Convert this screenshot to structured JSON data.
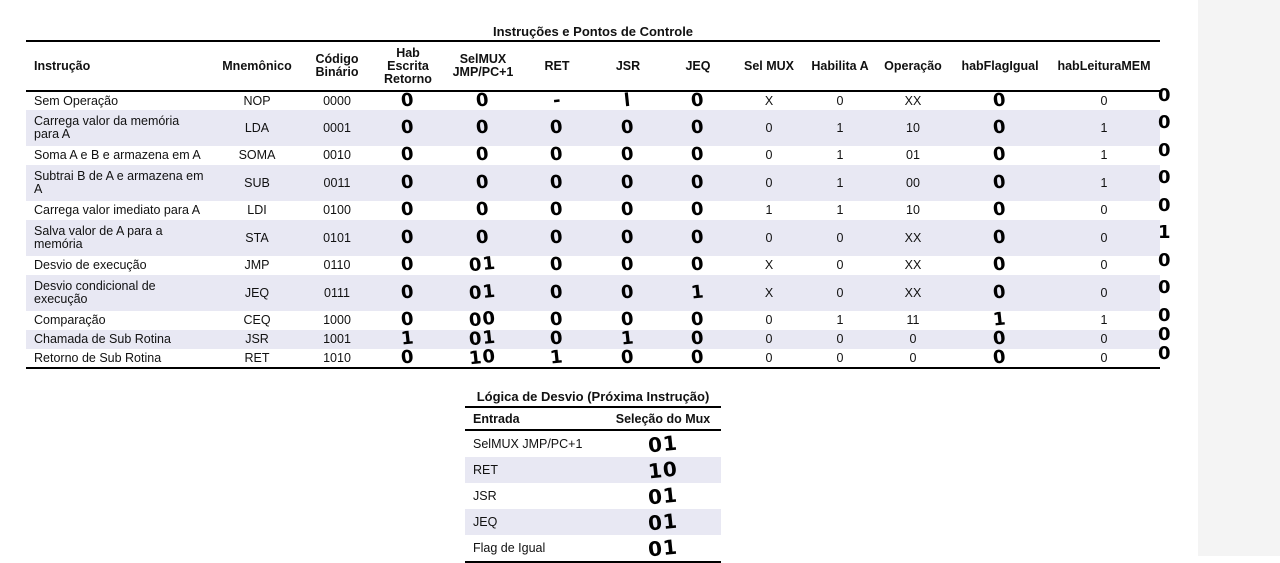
{
  "main_table": {
    "caption": "Instruções e Pontos de Controle",
    "headers": [
      "Instrução",
      "Mnemônico",
      "Código Binário",
      "Hab Escrita Retorno",
      "SelMUX JMP/PC+1",
      "RET",
      "JSR",
      "JEQ",
      "Sel MUX",
      "Habilita A",
      "Operação",
      "habFlagIgual",
      "habLeituraMEM"
    ],
    "rows": [
      {
        "instr": "Sem Operação",
        "mnem": "NOP",
        "bin": "0000",
        "hab_ret": "0",
        "selmux_jmp": "0",
        "ret": "-",
        "jsr": "l",
        "jeq": "0",
        "selmux": "X",
        "hab_a": "0",
        "op": "XX",
        "flag": "0",
        "mem": "0",
        "side": "0",
        "tall": false
      },
      {
        "instr": "Carrega valor da memória para A",
        "mnem": "LDA",
        "bin": "0001",
        "hab_ret": "0",
        "selmux_jmp": "0",
        "ret": "0",
        "jsr": "0",
        "jeq": "0",
        "selmux": "0",
        "hab_a": "1",
        "op": "10",
        "flag": "0",
        "mem": "1",
        "side": "0",
        "tall": true
      },
      {
        "instr": "Soma A e B e armazena em A",
        "mnem": "SOMA",
        "bin": "0010",
        "hab_ret": "0",
        "selmux_jmp": "0",
        "ret": "0",
        "jsr": "0",
        "jeq": "0",
        "selmux": "0",
        "hab_a": "1",
        "op": "01",
        "flag": "0",
        "mem": "1",
        "side": "0",
        "tall": false
      },
      {
        "instr": "Subtrai B de A e armazena em A",
        "mnem": "SUB",
        "bin": "0011",
        "hab_ret": "0",
        "selmux_jmp": "0",
        "ret": "0",
        "jsr": "0",
        "jeq": "0",
        "selmux": "0",
        "hab_a": "1",
        "op": "00",
        "flag": "0",
        "mem": "1",
        "side": "0",
        "tall": true
      },
      {
        "instr": "Carrega valor imediato para A",
        "mnem": "LDI",
        "bin": "0100",
        "hab_ret": "0",
        "selmux_jmp": "0",
        "ret": "0",
        "jsr": "0",
        "jeq": "0",
        "selmux": "1",
        "hab_a": "1",
        "op": "10",
        "flag": "0",
        "mem": "0",
        "side": "0",
        "tall": false
      },
      {
        "instr": "Salva valor de A para a memória",
        "mnem": "STA",
        "bin": "0101",
        "hab_ret": "0",
        "selmux_jmp": "0",
        "ret": "0",
        "jsr": "0",
        "jeq": "0",
        "selmux": "0",
        "hab_a": "0",
        "op": "XX",
        "flag": "0",
        "mem": "0",
        "side": "1",
        "tall": true
      },
      {
        "instr": "Desvio de execução",
        "mnem": "JMP",
        "bin": "0110",
        "hab_ret": "0",
        "selmux_jmp": "01",
        "ret": "0",
        "jsr": "0",
        "jeq": "0",
        "selmux": "X",
        "hab_a": "0",
        "op": "XX",
        "flag": "0",
        "mem": "0",
        "side": "0",
        "tall": false
      },
      {
        "instr": "Desvio condicional de execução",
        "mnem": "JEQ",
        "bin": "0111",
        "hab_ret": "0",
        "selmux_jmp": "01",
        "ret": "0",
        "jsr": "0",
        "jeq": "1",
        "selmux": "X",
        "hab_a": "0",
        "op": "XX",
        "flag": "0",
        "mem": "0",
        "side": "0",
        "tall": true
      },
      {
        "instr": "Comparação",
        "mnem": "CEQ",
        "bin": "1000",
        "hab_ret": "0",
        "selmux_jmp": "00",
        "ret": "0",
        "jsr": "0",
        "jeq": "0",
        "selmux": "0",
        "hab_a": "1",
        "op": "11",
        "flag": "1",
        "mem": "1",
        "side": "0",
        "tall": false
      },
      {
        "instr": "Chamada de Sub Rotina",
        "mnem": "JSR",
        "bin": "1001",
        "hab_ret": "1",
        "selmux_jmp": "01",
        "ret": "0",
        "jsr": "1",
        "jeq": "0",
        "selmux": "0",
        "hab_a": "0",
        "op": "0",
        "flag": "0",
        "mem": "0",
        "side": "0",
        "tall": false
      },
      {
        "instr": "Retorno de Sub Rotina",
        "mnem": "RET",
        "bin": "1010",
        "hab_ret": "0",
        "selmux_jmp": "10",
        "ret": "1",
        "jsr": "0",
        "jeq": "0",
        "selmux": "0",
        "hab_a": "0",
        "op": "0",
        "flag": "0",
        "mem": "0",
        "side": "0",
        "tall": false
      }
    ]
  },
  "logic_table": {
    "caption": "Lógica de Desvio (Próxima Instrução)",
    "headers": [
      "Entrada",
      "Seleção do Mux"
    ],
    "rows": [
      {
        "input": "SelMUX JMP/PC+1",
        "sel": "01"
      },
      {
        "input": "RET",
        "sel": "10"
      },
      {
        "input": "JSR",
        "sel": "01"
      },
      {
        "input": "JEQ",
        "sel": "01"
      },
      {
        "input": "Flag de Igual",
        "sel": "01"
      }
    ]
  }
}
